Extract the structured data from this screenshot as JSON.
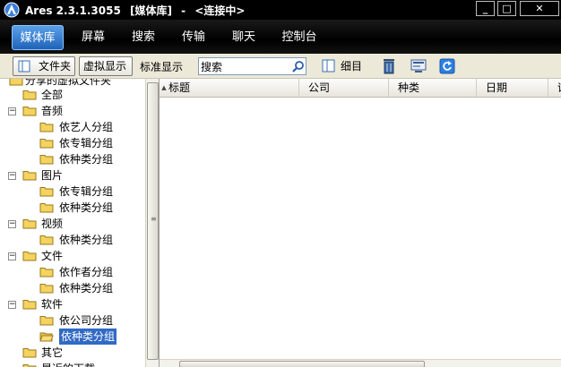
{
  "window": {
    "app_name": "Ares 2.3.1.3055",
    "section": "[媒体库]",
    "separator": "-",
    "status": "<连接中>",
    "min_glyph": "_",
    "max_glyph": "□",
    "close_glyph": "✕"
  },
  "nav": {
    "tabs": [
      {
        "label": "媒体库",
        "active": true
      },
      {
        "label": "屏幕"
      },
      {
        "label": "搜索"
      },
      {
        "label": "传输"
      },
      {
        "label": "聊天"
      },
      {
        "label": "控制台"
      }
    ]
  },
  "toolbar": {
    "folder_label": "文件夹",
    "virtual_label": "虚拟显示",
    "std_label": "标准显示",
    "search_value": "搜索",
    "detail_label": "细目",
    "icons": [
      "search-icon",
      "details-view-icon",
      "delete-icon",
      "screen-icon",
      "refresh-icon"
    ]
  },
  "tree": {
    "items": [
      {
        "label": "分享的虚拟文件夹"
      },
      {
        "label": "全部"
      },
      {
        "label": "音频"
      },
      {
        "label": "依艺人分组"
      },
      {
        "label": "依专辑分组"
      },
      {
        "label": "依种类分组"
      },
      {
        "label": "图片"
      },
      {
        "label": "依专辑分组"
      },
      {
        "label": "依种类分组"
      },
      {
        "label": "视频"
      },
      {
        "label": "依种类分组"
      },
      {
        "label": "文件"
      },
      {
        "label": "依作者分组"
      },
      {
        "label": "依种类分组"
      },
      {
        "label": "软件"
      },
      {
        "label": "依公司分组"
      },
      {
        "label": "依种类分组",
        "selected": true
      },
      {
        "label": "其它"
      },
      {
        "label": "最近的下载"
      }
    ],
    "expander_glyph": "−"
  },
  "columns": {
    "headers": [
      "标题",
      "公司",
      "种类",
      "日期",
      "评"
    ]
  },
  "colors": {
    "accent": "#316ac5",
    "nav_active": "#2a74cc",
    "folder": "#f4d35e"
  }
}
